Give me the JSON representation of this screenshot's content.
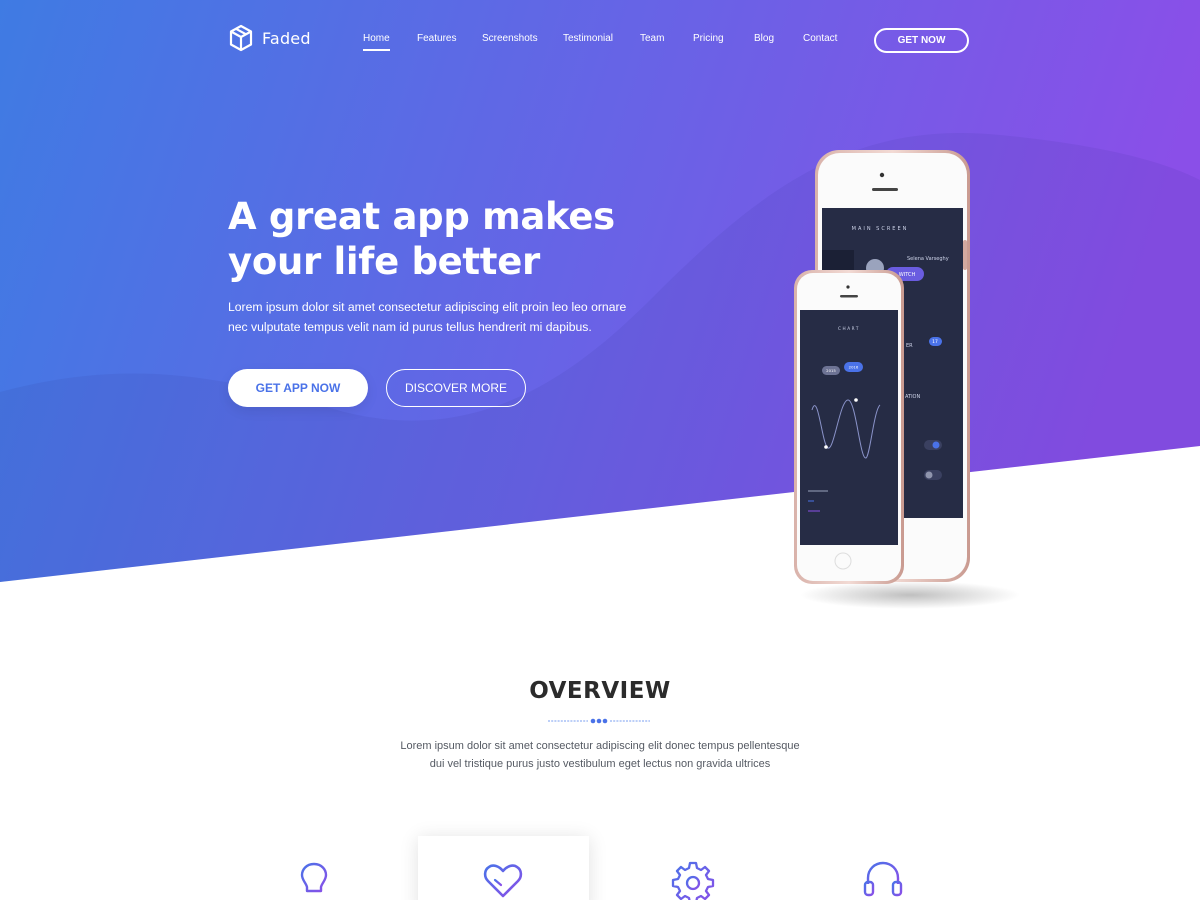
{
  "brand": {
    "name": "Faded",
    "logo_icon": "cube-logo-icon"
  },
  "nav": {
    "links": [
      {
        "label": "Home",
        "active": true
      },
      {
        "label": "Features",
        "active": false
      },
      {
        "label": "Screenshots",
        "active": false
      },
      {
        "label": "Testimonial",
        "active": false
      },
      {
        "label": "Team",
        "active": false
      },
      {
        "label": "Pricing",
        "active": false
      },
      {
        "label": "Blog",
        "active": false
      },
      {
        "label": "Contact",
        "active": false
      }
    ],
    "cta_label": "GET NOW"
  },
  "hero": {
    "headline_prefix": "A ",
    "headline_bold": "great",
    "headline_rest_line1": " app makes",
    "headline_line2": "your life better",
    "description": "Lorem ipsum dolor sit amet consectetur adipiscing elit proin leo leo ornare nec vulputate tempus velit nam id purus tellus hendrerit mi dapibus.",
    "primary_button": "GET APP NOW",
    "secondary_button": "DISCOVER MORE"
  },
  "phone_back_screen": {
    "title": "MAIN SCREEN",
    "user_name": "Selena Varseghy",
    "switch_label": "WITCH",
    "row_label_1": "ER",
    "badge_1": "17",
    "row_label_2": "ATION"
  },
  "phone_front_screen": {
    "title": "CHART",
    "pill_1": "2015",
    "pill_2": "2016"
  },
  "overview": {
    "title": "OVERVIEW",
    "description": "Lorem ipsum dolor sit amet consectetur adipiscing elit donec tempus pellentesque dui vel tristique purus justo vestibulum eget lectus non gravida ultrices"
  },
  "features": [
    {
      "icon": "lightbulb-icon"
    },
    {
      "icon": "heart-icon"
    },
    {
      "icon": "gear-icon"
    },
    {
      "icon": "headset-icon"
    }
  ],
  "colors": {
    "gradient_start": "#3f7be3",
    "gradient_end": "#8a4fe8",
    "accent": "#4a72e8",
    "icon_gradient_start": "#4a72e8",
    "icon_gradient_end": "#8a4fe8",
    "phone_frame": "#e8c8c2",
    "phone_screen": "#262c45"
  }
}
